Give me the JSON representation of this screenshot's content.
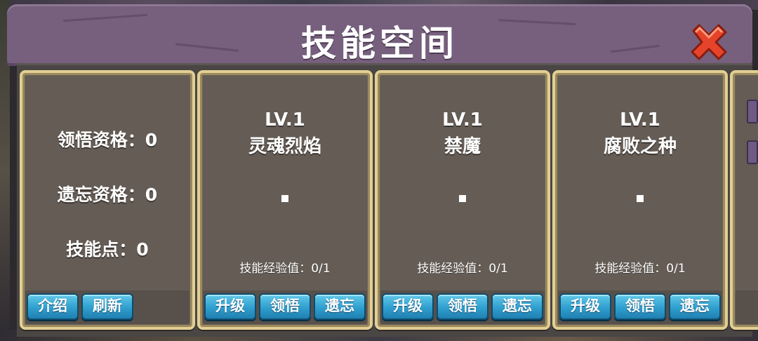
{
  "window": {
    "title": "技能空间",
    "close_icon": "close-x-icon"
  },
  "colors": {
    "title_bar": "#76607d",
    "card_border": "#e2cf94",
    "button": "#2f9fcf"
  },
  "status_panel": {
    "insight_qualification": "领悟资格：0",
    "forget_qualification": "遗忘资格：0",
    "skill_points": "技能点：0",
    "buttons": {
      "intro": "介绍",
      "refresh": "刷新"
    }
  },
  "skills": [
    {
      "level": "LV.1",
      "name": "灵魂烈焰",
      "exp": "技能经验值：0/1",
      "icon": "skill-icon-placeholder",
      "buttons": {
        "upgrade": "升级",
        "insight": "领悟",
        "forget": "遗忘"
      }
    },
    {
      "level": "LV.1",
      "name": "禁魔",
      "exp": "技能经验值：0/1",
      "icon": "skill-icon-placeholder",
      "buttons": {
        "upgrade": "升级",
        "insight": "领悟",
        "forget": "遗忘"
      }
    },
    {
      "level": "LV.1",
      "name": "腐败之种",
      "exp": "技能经验值：0/1",
      "icon": "skill-icon-placeholder",
      "buttons": {
        "upgrade": "升级",
        "insight": "领悟",
        "forget": "遗忘"
      }
    }
  ]
}
